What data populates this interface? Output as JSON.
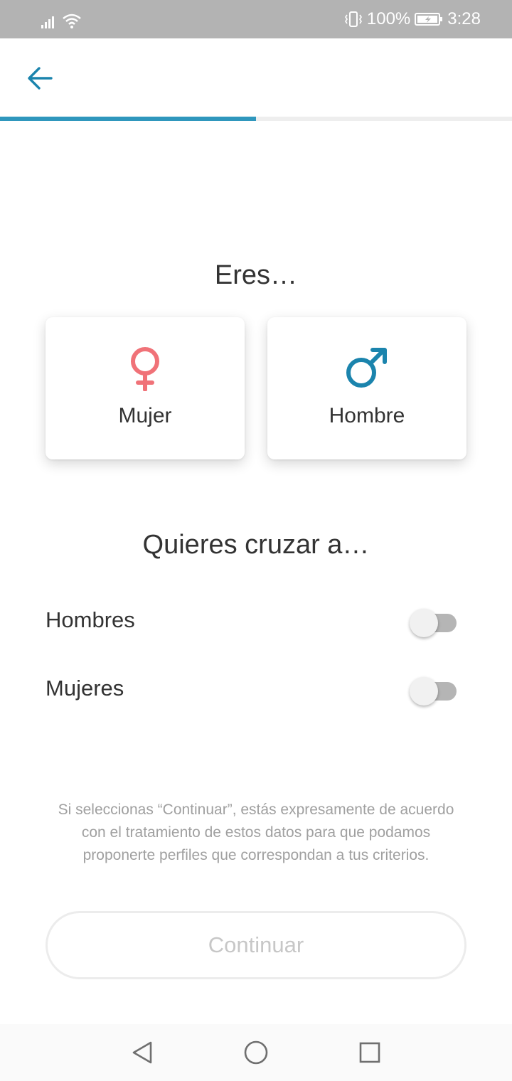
{
  "status_bar": {
    "battery": "100%",
    "time": "3:28",
    "icons": [
      "signal-icon",
      "wifi-icon",
      "vibrate-icon",
      "battery-icon"
    ]
  },
  "app_bar": {
    "back_icon": "arrow-left-icon",
    "progress": 0.5,
    "accent_color": "#2f97bd"
  },
  "gender_section": {
    "title": "Eres…",
    "options": [
      {
        "label": "Mujer",
        "icon": "female-symbol-icon",
        "color": "#f07278"
      },
      {
        "label": "Hombre",
        "icon": "male-symbol-icon",
        "color": "#1b84ad"
      }
    ]
  },
  "interest_section": {
    "title": "Quieres cruzar a…",
    "toggles": [
      {
        "label": "Hombres",
        "on": false
      },
      {
        "label": "Mujeres",
        "on": false
      }
    ]
  },
  "disclaimer": "Si seleccionas “Continuar”, estás expresamente de acuerdo con el tratamiento de estos datos para que podamos proponerte perfiles que correspondan a tus criterios.",
  "continue_button": {
    "label": "Continuar",
    "enabled": false
  },
  "nav_bar": {
    "icons": [
      "nav-back-icon",
      "nav-home-icon",
      "nav-recent-icon"
    ]
  }
}
